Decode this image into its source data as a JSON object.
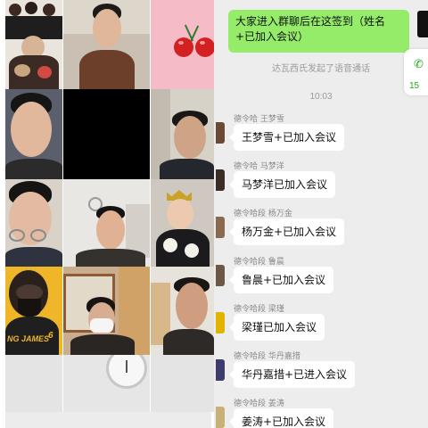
{
  "video_grid": {
    "tiles": [
      {
        "name": "tile-group-illustration",
        "kind": "illustration"
      },
      {
        "name": "tile-man-brown-sweater",
        "kind": "person"
      },
      {
        "name": "tile-cherry-sticker",
        "kind": "sticker"
      },
      {
        "name": "tile-man-blue-background",
        "kind": "person"
      },
      {
        "name": "tile-camera-off",
        "kind": "black"
      },
      {
        "name": "tile-man-dark-jacket",
        "kind": "person"
      },
      {
        "name": "tile-man-glasses",
        "kind": "person"
      },
      {
        "name": "tile-man-room",
        "kind": "person"
      },
      {
        "name": "tile-baby-crown",
        "kind": "person"
      },
      {
        "name": "tile-basketball-avatar",
        "kind": "illustration"
      },
      {
        "name": "tile-woman-mask",
        "kind": "person"
      },
      {
        "name": "tile-man-window",
        "kind": "person"
      },
      {
        "name": "tile-wall",
        "kind": "background"
      },
      {
        "name": "tile-wall-clock",
        "kind": "background"
      },
      {
        "name": "tile-empty",
        "kind": "background"
      }
    ],
    "basketball_text": "NG JAMES",
    "basketball_number": "6"
  },
  "chat": {
    "own_message": "大家进入群聊后在这签到（姓名+已加入会议）",
    "system_message": "达瓦西氏发起了语音通话",
    "float_icon": "phone-icon",
    "float_count": "15",
    "time": "10:03",
    "messages": [
      {
        "sender": "德令哈 王梦雪",
        "text": "王梦雪+已加入会议"
      },
      {
        "sender": "德令哈 马梦洋",
        "text": "马梦洋已加入会议"
      },
      {
        "sender": "德令哈段 杨万金",
        "text": "杨万金+已加入会议"
      },
      {
        "sender": "德令哈段 鲁晨",
        "text": "鲁晨+已加入会议"
      },
      {
        "sender": "德令哈段 梁瑾",
        "text": "梁瑾已加入会议"
      },
      {
        "sender": "德令哈段 华丹嘉措",
        "text": "华丹嘉措+已进入会议"
      },
      {
        "sender": "德令哈段 姜涛",
        "text": "姜涛+已加入会议"
      }
    ]
  }
}
